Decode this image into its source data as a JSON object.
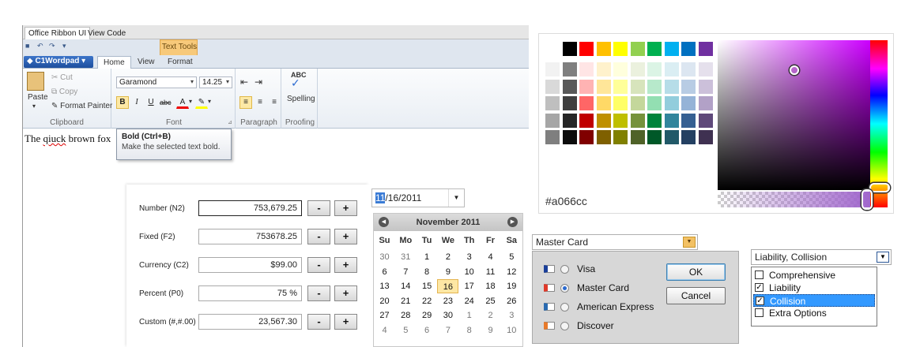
{
  "wordpad": {
    "view_tabs": [
      "Office Ribbon UI",
      "View Code"
    ],
    "contextual_group": "Text Tools",
    "file_button": "C1Wordpad",
    "ribbon_tabs": [
      "Home",
      "View",
      "Format"
    ],
    "clipboard": {
      "paste": "Paste",
      "cut": "Cut",
      "copy": "Copy",
      "format_painter": "Format Painter",
      "group": "Clipboard"
    },
    "font": {
      "family": "Garamond",
      "size": "14.25",
      "group": "Font"
    },
    "paragraph": {
      "group": "Paragraph"
    },
    "proofing": {
      "spelling": "Spelling",
      "abc": "ABC",
      "group": "Proofing"
    },
    "document": {
      "text_before": "The ",
      "misspelled": "qiuck",
      "text_after": " brown fox"
    },
    "tooltip": {
      "title": "Bold (Ctrl+B)",
      "description": "Make the selected text bold."
    }
  },
  "numeric": {
    "rows": [
      {
        "label": "Number (N2)",
        "value": "753,679.25"
      },
      {
        "label": "Fixed (F2)",
        "value": "753678.25"
      },
      {
        "label": "Currency (C2)",
        "value": "$99.00"
      },
      {
        "label": "Percent (P0)",
        "value": "75 %"
      },
      {
        "label": "Custom (#,#.00)",
        "value": "23,567.30"
      }
    ],
    "minus": "-",
    "plus": "+"
  },
  "datepicker": {
    "value_highlight": "11",
    "value_rest": "/16/2011",
    "month_label": "November 2011",
    "days_of_week": [
      "Su",
      "Mo",
      "Tu",
      "We",
      "Th",
      "Fr",
      "Sa"
    ],
    "weeks": [
      [
        "30",
        "31",
        "1",
        "2",
        "3",
        "4",
        "5"
      ],
      [
        "6",
        "7",
        "8",
        "9",
        "10",
        "11",
        "12"
      ],
      [
        "13",
        "14",
        "15",
        "16",
        "17",
        "18",
        "19"
      ],
      [
        "20",
        "21",
        "22",
        "23",
        "24",
        "25",
        "26"
      ],
      [
        "27",
        "28",
        "29",
        "30",
        "1",
        "2",
        "3"
      ],
      [
        "4",
        "5",
        "6",
        "7",
        "8",
        "9",
        "10"
      ]
    ],
    "selected_day": "16"
  },
  "colorpicker": {
    "hex": "#a066cc",
    "hue_color": "#cc00ff",
    "hue_position": 0.88,
    "saturation": 0.5,
    "value": 0.8,
    "alpha": 1.0,
    "base_colors": [
      "#000000",
      "#ff0000",
      "#ffc000",
      "#ffff00",
      "#92d050",
      "#00b050",
      "#00b0f0",
      "#0070c0",
      "#7030a0"
    ],
    "shade_grid": [
      [
        "#f2f2f2",
        "#7f7f7f",
        "#ffe5e5",
        "#fff2cc",
        "#ffffdd",
        "#ebf1de",
        "#dbf4e5",
        "#daeef3",
        "#dce6f1",
        "#e5e0ec"
      ],
      [
        "#d9d9d9",
        "#595959",
        "#ffb3b3",
        "#ffe699",
        "#ffff99",
        "#d7e4bc",
        "#b7e9cb",
        "#b6dde8",
        "#b8cce4",
        "#ccc0da"
      ],
      [
        "#bfbfbf",
        "#3f3f3f",
        "#ff6666",
        "#ffd966",
        "#ffff66",
        "#c4d79b",
        "#93dfb2",
        "#92cddc",
        "#95b3d7",
        "#b2a1c7"
      ],
      [
        "#a6a6a6",
        "#262626",
        "#c00000",
        "#bf9000",
        "#bfbf00",
        "#76923c",
        "#00843c",
        "#31859c",
        "#366092",
        "#5f497a"
      ],
      [
        "#7f7f7f",
        "#0c0c0c",
        "#800000",
        "#7f6000",
        "#808000",
        "#4f6228",
        "#005828",
        "#215968",
        "#244062",
        "#3f3151"
      ]
    ]
  },
  "creditcard": {
    "selected": "Master Card",
    "options": [
      {
        "label": "Visa",
        "checked": false,
        "color": "#1a3f99"
      },
      {
        "label": "Master Card",
        "checked": true,
        "color": "#e03a2a"
      },
      {
        "label": "American Express",
        "checked": false,
        "color": "#2a6ab0"
      },
      {
        "label": "Discover",
        "checked": false,
        "color": "#e87a2a"
      }
    ],
    "ok": "OK",
    "cancel": "Cancel"
  },
  "checklist": {
    "value": "Liability, Collision",
    "items": [
      {
        "label": "Comprehensive",
        "checked": false
      },
      {
        "label": "Liability",
        "checked": true
      },
      {
        "label": "Collision",
        "checked": true
      },
      {
        "label": "Extra Options",
        "checked": false
      }
    ]
  }
}
